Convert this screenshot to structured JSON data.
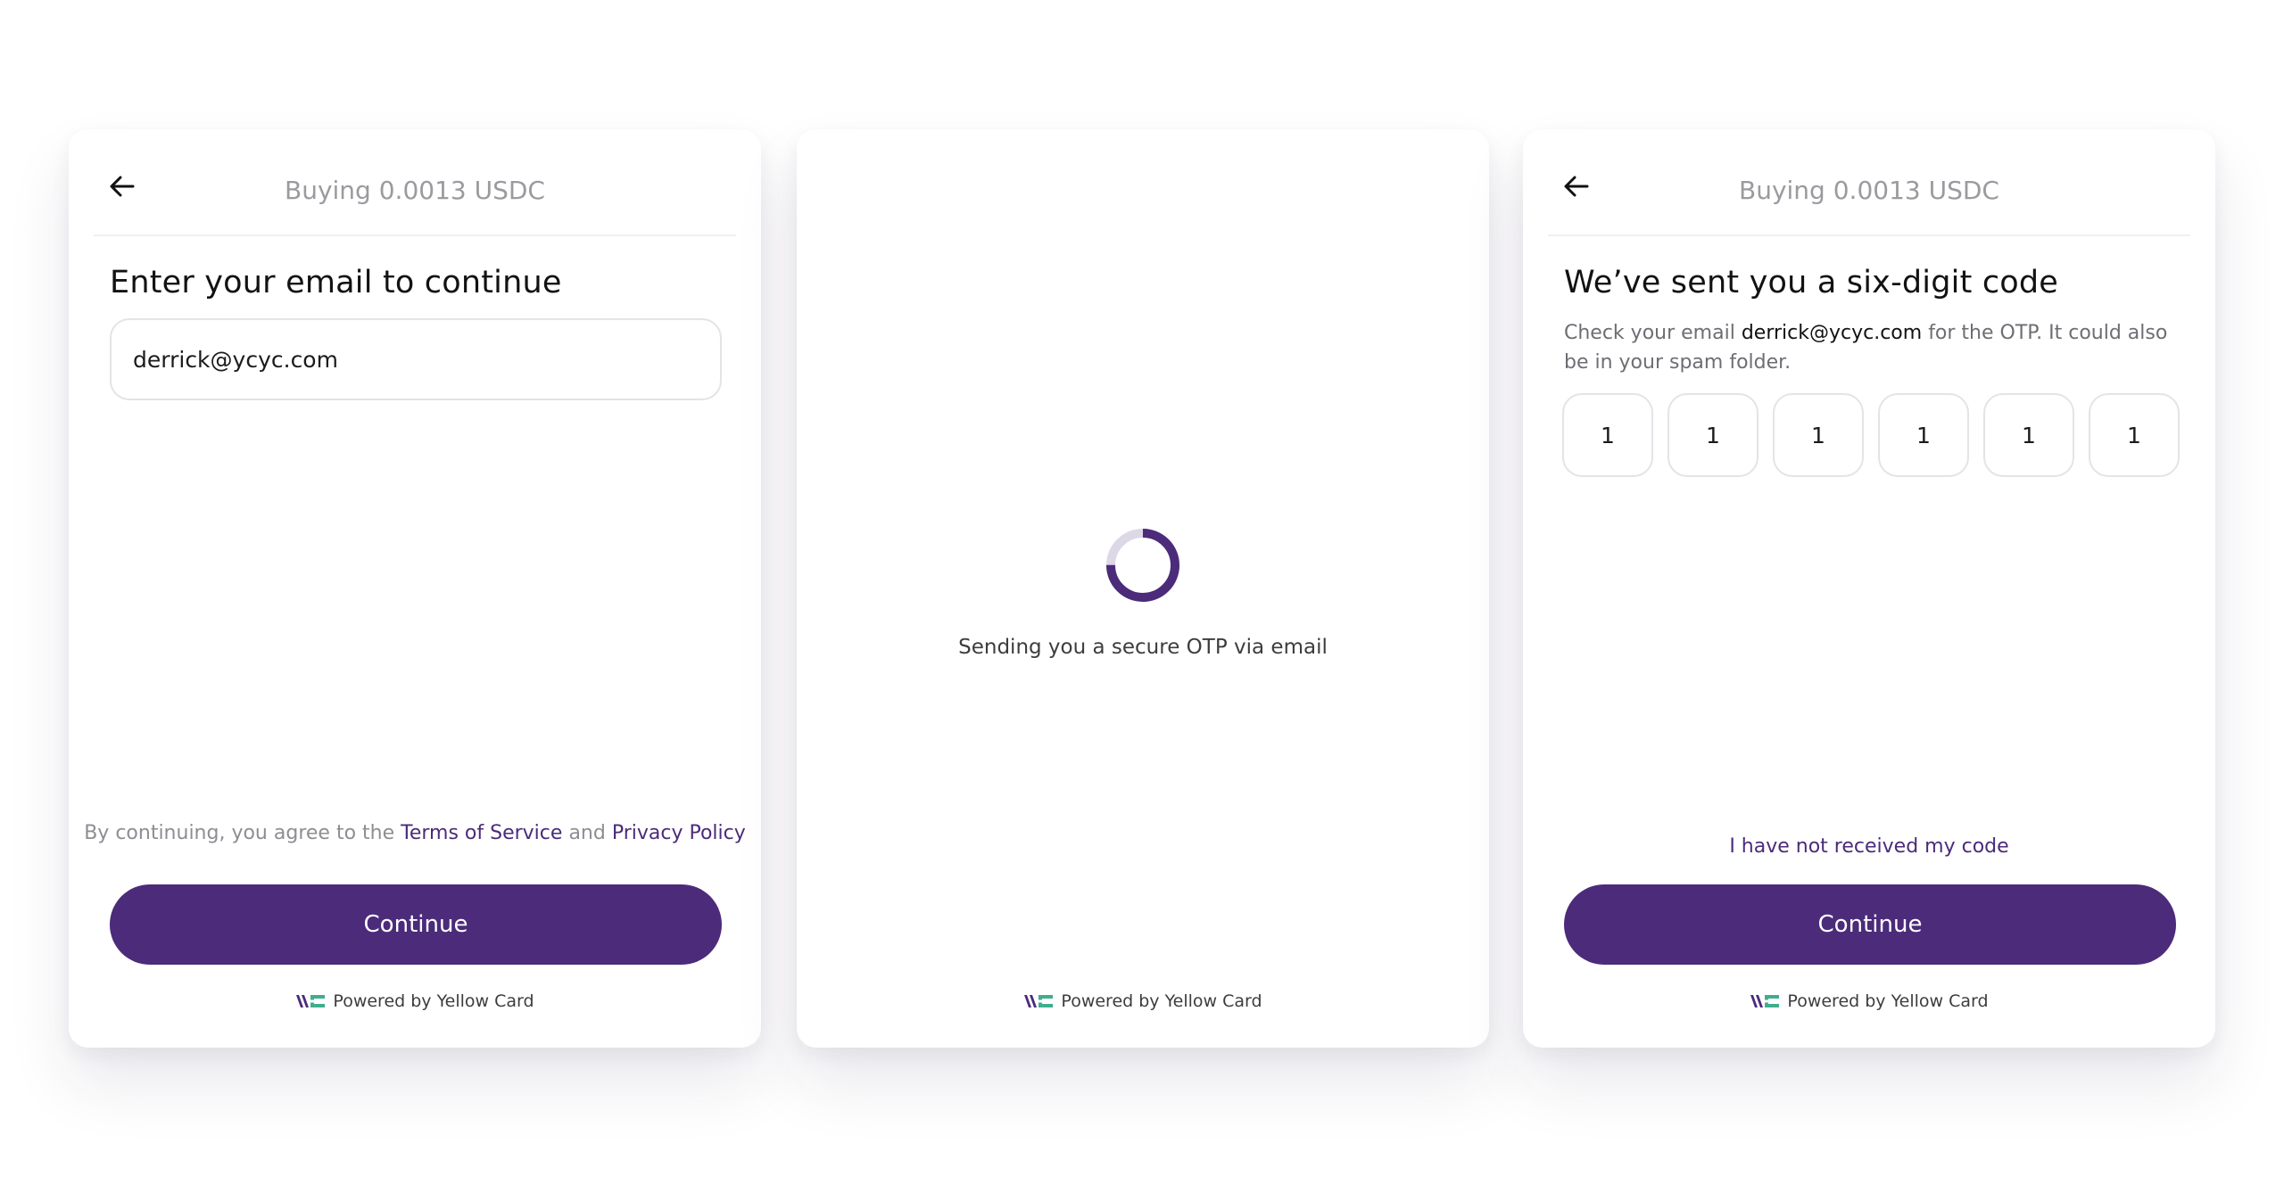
{
  "colors": {
    "brand_purple": "#4b2b7a",
    "muted_text": "#9b9a9f",
    "border": "#e4e3e8",
    "logo_purple": "#4b2b7a",
    "logo_green": "#3fae8e"
  },
  "icons": {
    "back": "arrow-left-icon",
    "spinner": "loading-spinner-icon",
    "logo": "yellow-card-logo-icon"
  },
  "email_screen": {
    "header_title": "Buying 0.0013 USDC",
    "heading": "Enter your email to continue",
    "email_value": "derrick@ycyc.com",
    "terms_prefix": "By continuing, you agree to the",
    "terms_link": "Terms of Service",
    "terms_and": "and",
    "privacy_link": "Privacy Policy",
    "continue_label": "Continue",
    "powered_by": "Powered by Yellow Card"
  },
  "loading_screen": {
    "spinner_progress": 0.75,
    "message": "Sending you a secure OTP via email",
    "powered_by": "Powered by Yellow Card"
  },
  "otp_screen": {
    "header_title": "Buying 0.0013 USDC",
    "heading": "We’ve sent you a six-digit code",
    "desc_prefix": "Check your email",
    "desc_email": "derrick@ycyc.com",
    "desc_suffix": "for the OTP. It could also be in your spam folder.",
    "digits": [
      "1",
      "1",
      "1",
      "1",
      "1",
      "1"
    ],
    "resend_label": "I have not received my code",
    "continue_label": "Continue",
    "powered_by": "Powered by Yellow Card"
  }
}
